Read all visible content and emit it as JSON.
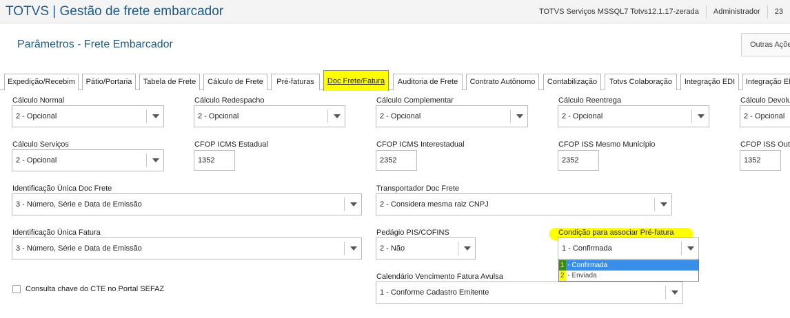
{
  "header": {
    "app_title": "TOTVS | Gestão de frete embarcador",
    "environment": "TOTVS Serviços MSSQL7 Totvs12.1.17-zerada",
    "user": "Administrador",
    "date_partial": "23"
  },
  "page": {
    "title": "Parâmetros - Frete Embarcador",
    "outras_acoes": "Outras Açõe"
  },
  "tabs": [
    {
      "label": "Expedição/Recebim"
    },
    {
      "label": "Pátio/Portaria"
    },
    {
      "label": "Tabela de Frete"
    },
    {
      "label": "Cálculo de Frete"
    },
    {
      "label": "Pré-faturas"
    },
    {
      "label": "Doc Frete/Fatura"
    },
    {
      "label": "Auditoria de Frete"
    },
    {
      "label": "Contrato Autônomo"
    },
    {
      "label": "Contabilização"
    },
    {
      "label": "Totvs Colaboração"
    },
    {
      "label": "Integração EDI"
    },
    {
      "label": "Integração EI"
    }
  ],
  "form": {
    "calc_normal": {
      "label": "Cálculo Normal",
      "value": "2 - Opcional"
    },
    "calc_redespacho": {
      "label": "Cálculo Redespacho",
      "value": "2 - Opcional"
    },
    "calc_complementar": {
      "label": "Cálculo Complementar",
      "value": "2 - Opcional"
    },
    "calc_reentrega": {
      "label": "Cálculo Reentrega",
      "value": "2 - Opcional"
    },
    "calc_devolucao": {
      "label": "Cálculo Devolu",
      "value": "2 - Opcional"
    },
    "calc_servicos": {
      "label": "Cálculo Serviços",
      "value": "2 - Opcional"
    },
    "cfop_icms_estadual": {
      "label": "CFOP ICMS Estadual",
      "value": "1352"
    },
    "cfop_icms_interestadual": {
      "label": "CFOP ICMS Interestadual",
      "value": "2352"
    },
    "cfop_iss_mesmo_municipio": {
      "label": "CFOP ISS Mesmo Município",
      "value": "2352"
    },
    "cfop_iss_outro": {
      "label": "CFOP ISS Outro",
      "value": "1352"
    },
    "ident_unica_doc_frete": {
      "label": "Identificação Única Doc Frete",
      "value": "3 - Número, Série e Data de Emissão"
    },
    "transportador_doc_frete": {
      "label": "Transportador Doc Frete",
      "value": "2 - Considera mesma raiz CNPJ"
    },
    "ident_unica_fatura": {
      "label": "Identificação Única Fatura",
      "value": "3 - Número, Série e Data de Emissão"
    },
    "pedagio_pis_cofins": {
      "label": "Pedágio PIS/COFINS",
      "value": "2 - Não"
    },
    "condicao_pre_fatura": {
      "label": "Condição para associar Pré-fatura",
      "value": "1 - Confirmada",
      "options": [
        {
          "num": "1",
          "rest": " - Confirmada"
        },
        {
          "num": "2",
          "rest": " - Enviada"
        }
      ]
    },
    "consulta_chave_cte": {
      "label": "Consulta chave do CTE no Portal SEFAZ",
      "checked": false
    },
    "calendario_vencimento": {
      "label": "Calendário Vencimento Fatura Avulsa",
      "value": "1 - Conforme Cadastro Emitente"
    }
  },
  "colors": {
    "title_blue": "#1e5a8c",
    "highlight": "#ffff00",
    "option_selected": "#3b8ee8"
  }
}
